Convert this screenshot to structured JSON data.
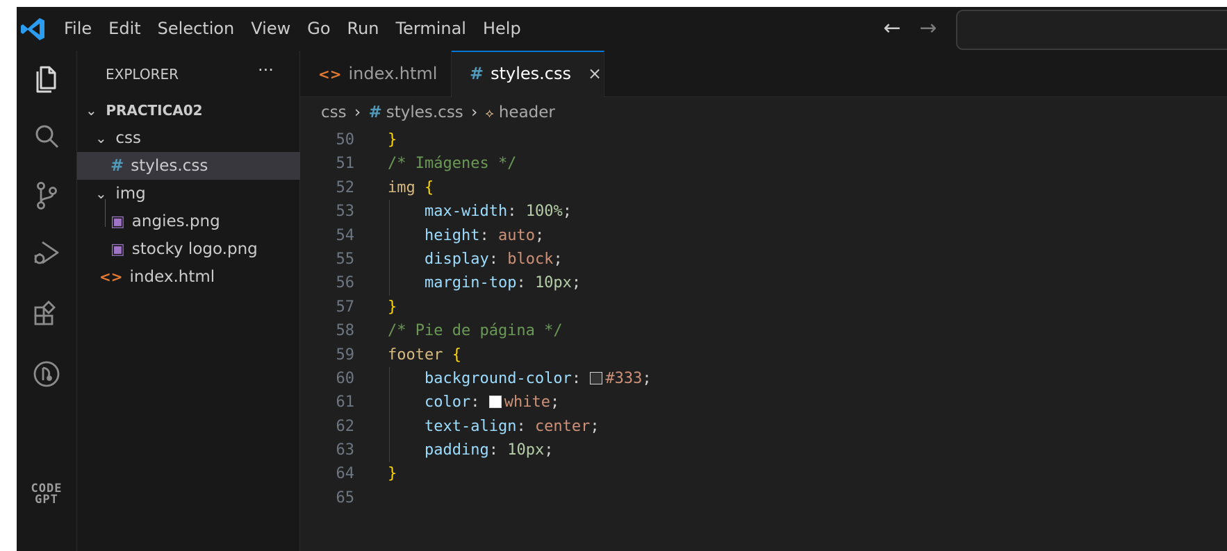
{
  "menu": [
    "File",
    "Edit",
    "Selection",
    "View",
    "Go",
    "Run",
    "Terminal",
    "Help"
  ],
  "nav": {
    "back": "←",
    "forward": "→"
  },
  "activity_bar": {
    "icons": [
      "explorer-icon",
      "search-icon",
      "source-control-icon",
      "run-debug-icon",
      "extensions-icon",
      "git-graph-icon",
      "codegpt-icon"
    ],
    "codegpt_label": "CODE\nGPT"
  },
  "sidebar": {
    "title": "EXPLORER",
    "more": "···",
    "root": "PRACTICA02",
    "folders": {
      "css": {
        "label": "css",
        "files": [
          "styles.css"
        ]
      },
      "img": {
        "label": "img",
        "files": [
          "angies.png",
          "stocky logo.png"
        ]
      }
    },
    "root_files": [
      "index.html"
    ]
  },
  "tabs": [
    {
      "label": "index.html",
      "icon": "html-icon",
      "active": false
    },
    {
      "label": "styles.css",
      "icon": "css-hash-icon",
      "active": true,
      "close": "×"
    }
  ],
  "breadcrumbs": [
    "css",
    "styles.css",
    "header"
  ],
  "code": {
    "lines": [
      {
        "n": "50",
        "text": "}"
      },
      {
        "n": "51",
        "text": "/* Imágenes */"
      },
      {
        "n": "52",
        "sel": "img",
        "brace": "{"
      },
      {
        "n": "53",
        "prop": "max-width",
        "value": "100%",
        "kind": "num"
      },
      {
        "n": "54",
        "prop": "height",
        "value": "auto",
        "kind": "val"
      },
      {
        "n": "55",
        "prop": "display",
        "value": "block",
        "kind": "val"
      },
      {
        "n": "56",
        "prop": "margin-top",
        "value": "10px",
        "kind": "num"
      },
      {
        "n": "57",
        "text": "}"
      },
      {
        "n": "58",
        "text": "/* Pie de página */"
      },
      {
        "n": "59",
        "sel": "footer",
        "brace": "{"
      },
      {
        "n": "60",
        "prop": "background-color",
        "value": "#333",
        "kind": "val",
        "swatch": "#333333"
      },
      {
        "n": "61",
        "prop": "color",
        "value": "white",
        "kind": "val",
        "swatch": "#ffffff"
      },
      {
        "n": "62",
        "prop": "text-align",
        "value": "center",
        "kind": "val"
      },
      {
        "n": "63",
        "prop": "padding",
        "value": "10px",
        "kind": "num"
      },
      {
        "n": "64",
        "text": "}"
      },
      {
        "n": "65",
        "text": ""
      }
    ]
  },
  "colors": {
    "accent": "#0078d4",
    "html_icon": "#e37933",
    "css_icon": "#519aba",
    "image_icon": "#a074c4"
  }
}
